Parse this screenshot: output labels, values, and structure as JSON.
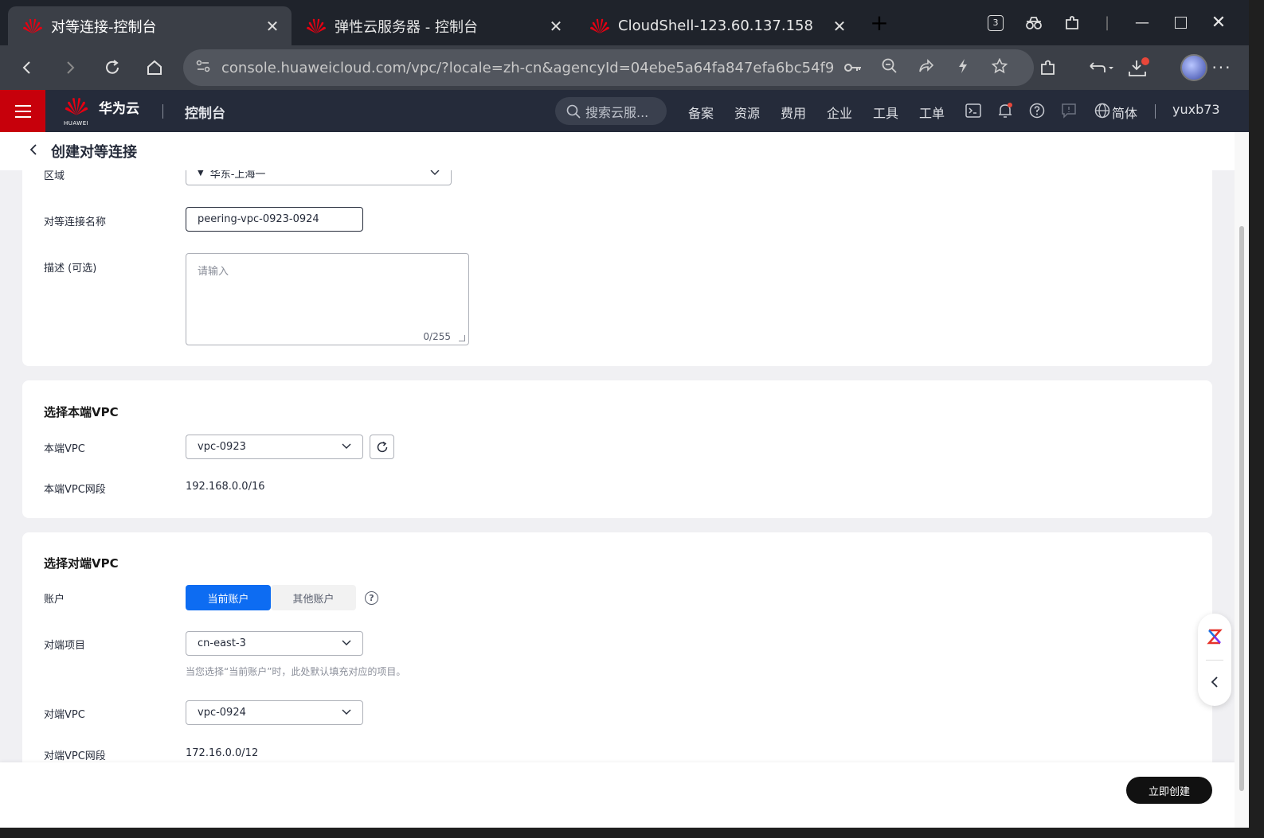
{
  "browser": {
    "tabs": [
      {
        "title": "对等连接-控制台",
        "active": true
      },
      {
        "title": "弹性云服务器 - 控制台",
        "active": false
      },
      {
        "title": "CloudShell-123.60.137.158",
        "active": false
      }
    ],
    "tab_counter": "3",
    "url": "console.huaweicloud.com/vpc/?locale=zh-cn&agencyId=04ebe5a64fa847efa6bc54f919..."
  },
  "header": {
    "brand_small": "HUAWEI",
    "brand": "华为云",
    "console": "控制台",
    "search_placeholder": "搜索云服...",
    "nav": [
      "备案",
      "资源",
      "费用",
      "企业",
      "工具",
      "工单"
    ],
    "lang": "简体",
    "user": "yuxb73"
  },
  "page": {
    "title": "创建对等连接",
    "basic": {
      "region_label": "区域",
      "region_value": "华东-上海一",
      "name_label": "对等连接名称",
      "name_value": "peering-vpc-0923-0924",
      "desc_label": "描述 (可选)",
      "desc_placeholder": "请输入",
      "desc_counter": "0/255"
    },
    "local": {
      "section_title": "选择本端VPC",
      "vpc_label": "本端VPC",
      "vpc_value": "vpc-0923",
      "cidr_label": "本端VPC网段",
      "cidr_value": "192.168.0.0/16"
    },
    "peer": {
      "section_title": "选择对端VPC",
      "account_label": "账户",
      "account_options": [
        "当前账户",
        "其他账户"
      ],
      "project_label": "对端项目",
      "project_value": "cn-east-3",
      "project_hint": "当您选择“当前账户”时，此处默认填充对应的项目。",
      "vpc_label": "对端VPC",
      "vpc_value": "vpc-0924",
      "cidr_label": "对端VPC网段",
      "cidr_value": "172.16.0.0/12"
    },
    "create_button": "立即创建"
  },
  "colors": {
    "brand_red": "#c7000b",
    "primary_blue": "#0d6cf2",
    "header_bg": "#252b3a"
  }
}
